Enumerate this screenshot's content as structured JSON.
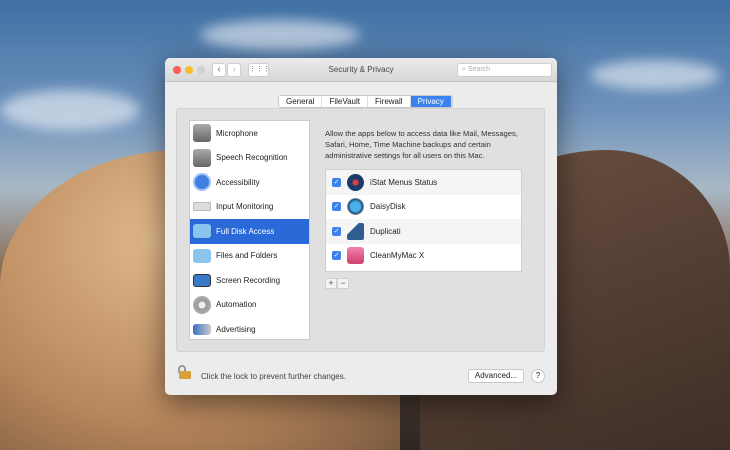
{
  "window": {
    "title": "Security & Privacy",
    "search_placeholder": "Search"
  },
  "tabs": [
    {
      "label": "General"
    },
    {
      "label": "FileVault"
    },
    {
      "label": "Firewall"
    },
    {
      "label": "Privacy",
      "selected": true
    }
  ],
  "sidebar": {
    "items": [
      {
        "label": "Microphone",
        "icon": "microphone-icon"
      },
      {
        "label": "Speech Recognition",
        "icon": "microphone-icon"
      },
      {
        "label": "Accessibility",
        "icon": "accessibility-icon"
      },
      {
        "label": "Input Monitoring",
        "icon": "keyboard-icon"
      },
      {
        "label": "Full Disk Access",
        "icon": "folder-icon",
        "selected": true
      },
      {
        "label": "Files and Folders",
        "icon": "folder-icon"
      },
      {
        "label": "Screen Recording",
        "icon": "monitor-icon"
      },
      {
        "label": "Automation",
        "icon": "gear-icon"
      },
      {
        "label": "Advertising",
        "icon": "megaphone-icon"
      }
    ]
  },
  "main": {
    "description": "Allow the apps below to access data like Mail, Messages, Safari, Home, Time Machine backups and certain administrative settings for all users on this Mac.",
    "apps": [
      {
        "name": "iStat Menus Status",
        "checked": true
      },
      {
        "name": "DaisyDisk",
        "checked": true
      },
      {
        "name": "Duplicati",
        "checked": true
      },
      {
        "name": "CleanMyMac X",
        "checked": true
      }
    ],
    "add_label": "+",
    "remove_label": "−"
  },
  "footer": {
    "lock_text": "Click the lock to prevent further changes.",
    "advanced_label": "Advanced...",
    "help_label": "?"
  },
  "colors": {
    "accent": "#3b82f0",
    "selection": "#2a6ad8"
  }
}
